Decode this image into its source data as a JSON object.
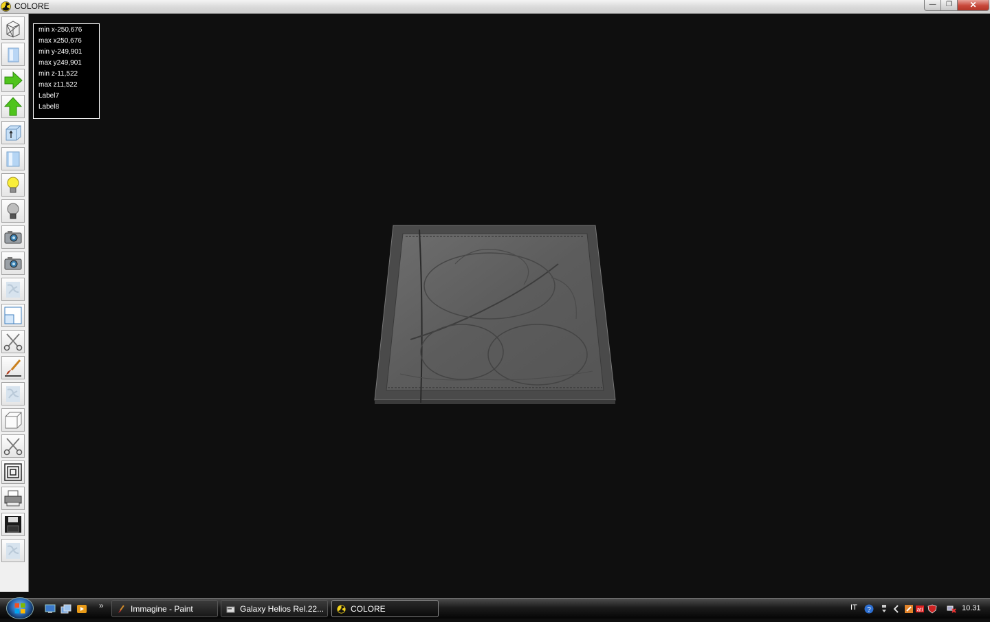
{
  "window": {
    "title": "COLORE",
    "minimize_label": "—",
    "maximize_label": "❐",
    "close_label": "✕"
  },
  "toolbar": {
    "tools": [
      {
        "id": "wireframe",
        "icon": "wireframe-box-icon"
      },
      {
        "id": "solid",
        "icon": "solid-box-icon"
      },
      {
        "id": "rotate-right",
        "icon": "green-arrow-right-icon"
      },
      {
        "id": "rotate-up",
        "icon": "green-arrow-up-icon"
      },
      {
        "id": "box-up",
        "icon": "box-arrow-up-icon"
      },
      {
        "id": "cylinder",
        "icon": "cylinder-icon"
      },
      {
        "id": "light-on",
        "icon": "lightbulb-on-icon"
      },
      {
        "id": "light-off",
        "icon": "lightbulb-off-icon"
      },
      {
        "id": "camera-1",
        "icon": "camera-icon"
      },
      {
        "id": "camera-2",
        "icon": "camera-icon"
      },
      {
        "id": "texture-1",
        "icon": "marble-texture-icon"
      },
      {
        "id": "window-view",
        "icon": "window-view-icon"
      },
      {
        "id": "cut-1",
        "icon": "scissors-icon"
      },
      {
        "id": "brush",
        "icon": "paint-brush-icon"
      },
      {
        "id": "texture-2",
        "icon": "marble-texture-icon"
      },
      {
        "id": "white-box",
        "icon": "white-box-icon"
      },
      {
        "id": "cut-2",
        "icon": "scissors-icon"
      },
      {
        "id": "concentric",
        "icon": "concentric-squares-icon"
      },
      {
        "id": "print",
        "icon": "printer-icon"
      },
      {
        "id": "save",
        "icon": "floppy-disk-icon"
      },
      {
        "id": "texture-3",
        "icon": "marble-texture-icon"
      }
    ]
  },
  "info_panel": {
    "min_x": "min x-250,676",
    "max_x": "max x250,676",
    "min_y": "min y-249,901",
    "max_y": "max y249,901",
    "min_z": "min z-11,522",
    "max_z": "max z11,522",
    "label7": "Label7",
    "label8": "Label8"
  },
  "taskbar": {
    "quick_launch": [
      "show-desktop-icon",
      "switch-windows-icon",
      "media-player-icon"
    ],
    "more": "»",
    "tasks": [
      {
        "label": "Immagine - Paint",
        "icon": "paint-icon",
        "active": false
      },
      {
        "label": "Galaxy Helios  Rel.22...",
        "icon": "folder-app-icon",
        "active": false
      },
      {
        "label": "COLORE",
        "icon": "radiation-icon",
        "active": true
      }
    ],
    "tray": {
      "language": "IT",
      "clock": "10.31"
    }
  }
}
